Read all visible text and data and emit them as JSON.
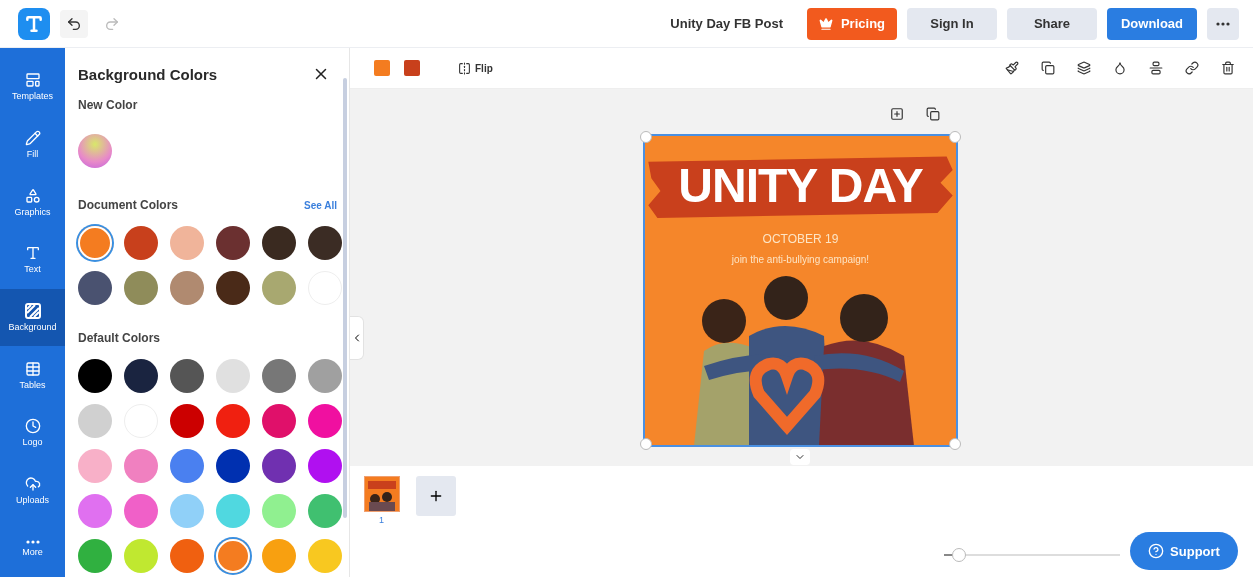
{
  "topbar": {
    "document_title": "Unity Day FB Post",
    "buttons": [
      {
        "label": "Pricing",
        "kind": "pricing"
      },
      {
        "label": "Sign In",
        "kind": "plain"
      },
      {
        "label": "Share",
        "kind": "plain"
      },
      {
        "label": "Download",
        "kind": "primary"
      }
    ]
  },
  "sidebar": {
    "items": [
      {
        "label": "Templates",
        "kind": "templates",
        "selected": false
      },
      {
        "label": "Fill",
        "kind": "fill",
        "selected": false
      },
      {
        "label": "Graphics",
        "kind": "graphics",
        "selected": false
      },
      {
        "label": "Text",
        "kind": "text",
        "selected": false
      },
      {
        "label": "Background",
        "kind": "background",
        "selected": true
      },
      {
        "label": "Tables",
        "kind": "tables",
        "selected": false
      },
      {
        "label": "Logo",
        "kind": "logo",
        "selected": false
      },
      {
        "label": "Uploads",
        "kind": "uploads",
        "selected": false
      },
      {
        "label": "More",
        "kind": "more",
        "selected": false
      }
    ]
  },
  "panel": {
    "title": "Background Colors",
    "new_color_label": "New Color",
    "document_colors": {
      "label": "Document Colors",
      "link": "See All",
      "swatches": [
        {
          "color": "#f47c20",
          "selected": true
        },
        {
          "color": "#c8401c",
          "selected": false
        },
        {
          "color": "#f0b49a",
          "selected": false
        },
        {
          "color": "#6b3030",
          "selected": false
        },
        {
          "color": "#3a2a20",
          "selected": false
        },
        {
          "color": "#3b2c24",
          "selected": false
        },
        {
          "color": "#4a5270",
          "selected": false
        },
        {
          "color": "#8f8c5a",
          "selected": false
        },
        {
          "color": "#b08a70",
          "selected": false
        },
        {
          "color": "#4a2a18",
          "selected": false
        },
        {
          "color": "#a8a870",
          "selected": false
        },
        {
          "color": "#ffffff",
          "selected": false
        }
      ]
    },
    "default_colors": {
      "label": "Default Colors",
      "swatches": [
        {
          "color": "#000000",
          "selected": false
        },
        {
          "color": "#1a2440",
          "selected": false
        },
        {
          "color": "#555555",
          "selected": false
        },
        {
          "color": "#e0e0e0",
          "selected": false
        },
        {
          "color": "#777777",
          "selected": false
        },
        {
          "color": "#a0a0a0",
          "selected": false
        },
        {
          "color": "#d0d0d0",
          "selected": false
        },
        {
          "color": "#ffffff",
          "selected": false
        },
        {
          "color": "#cc0000",
          "selected": false
        },
        {
          "color": "#f02010",
          "selected": false
        },
        {
          "color": "#e0106a",
          "selected": false
        },
        {
          "color": "#f010a0",
          "selected": false
        },
        {
          "color": "#f8b0c8",
          "selected": false
        },
        {
          "color": "#f080c0",
          "selected": false
        },
        {
          "color": "#4a80f0",
          "selected": false
        },
        {
          "color": "#0030b0",
          "selected": false
        },
        {
          "color": "#7030b0",
          "selected": false
        },
        {
          "color": "#b010f0",
          "selected": false
        },
        {
          "color": "#e070f0",
          "selected": false
        },
        {
          "color": "#f060c8",
          "selected": false
        },
        {
          "color": "#90d0f8",
          "selected": false
        },
        {
          "color": "#50d8e0",
          "selected": false
        },
        {
          "color": "#90f090",
          "selected": false
        },
        {
          "color": "#40c070",
          "selected": false
        },
        {
          "color": "#30b040",
          "selected": false
        },
        {
          "color": "#c0e830",
          "selected": false
        },
        {
          "color": "#f06010",
          "selected": false
        },
        {
          "color": "#f47c20",
          "selected": true
        },
        {
          "color": "#f8a010",
          "selected": false
        },
        {
          "color": "#f8c820",
          "selected": false
        }
      ]
    }
  },
  "toolbar": {
    "colors": [
      {
        "color": "#f47c20"
      },
      {
        "color": "#c8401c"
      }
    ],
    "flip_label": "Flip"
  },
  "poster": {
    "title": "UNITY DAY",
    "date": "OCTOBER 19",
    "tagline": "join the anti-bullying campaign!"
  },
  "pages": [
    {
      "number": "1",
      "selected": true
    }
  ],
  "zoom": {
    "level": 0.05
  },
  "support": {
    "label": "Support"
  }
}
